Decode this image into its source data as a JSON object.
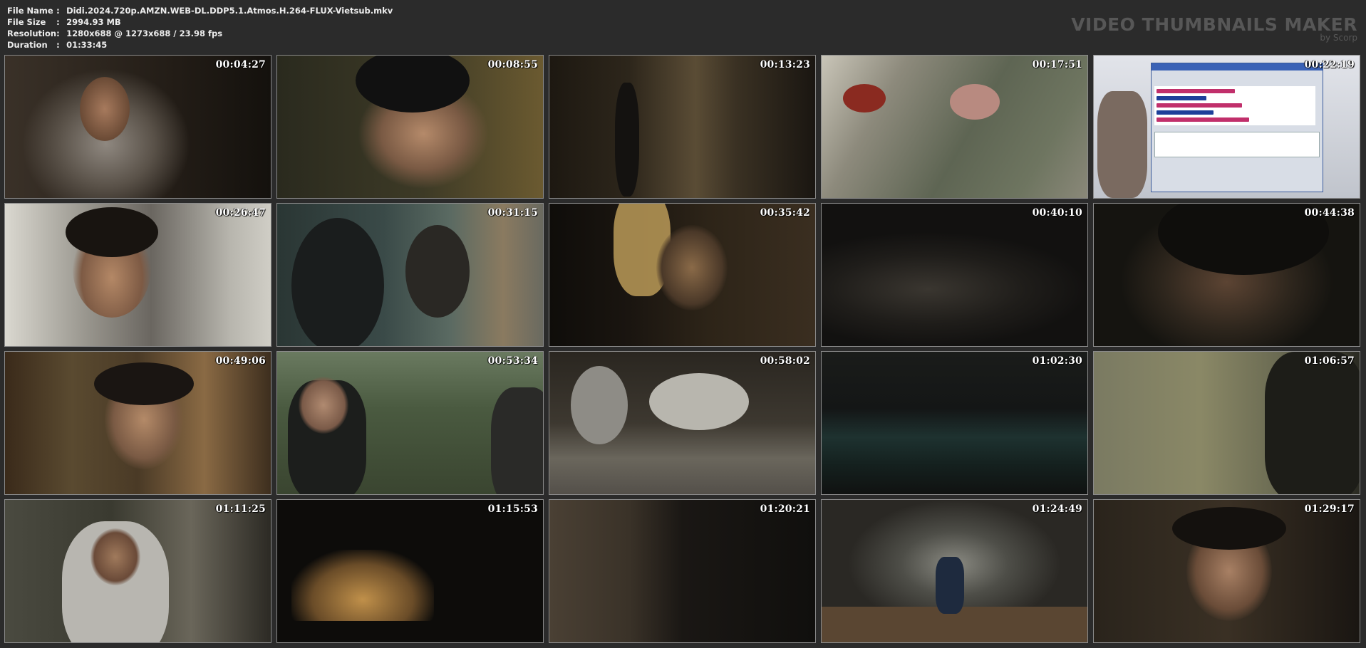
{
  "file_info": [
    {
      "key": "File Name",
      "value": "Didi.2024.720p.AMZN.WEB-DL.DDP5.1.Atmos.H.264-FLUX-Vietsub.mkv"
    },
    {
      "key": "File Size",
      "value": "2994.93 MB"
    },
    {
      "key": "Resolution",
      "value": "1280x688 @ 1273x688 / 23.98 fps"
    },
    {
      "key": "Duration",
      "value": "01:33:45"
    }
  ],
  "brand": {
    "title": "VIDEO THUMBNAILS MAKER",
    "subtitle": "by Scorp"
  },
  "thumbnails": [
    {
      "time": "00:04:27",
      "bg": "#2a241d"
    },
    {
      "time": "00:08:55",
      "bg": "#3a3524"
    },
    {
      "time": "00:13:23",
      "bg": "#2a2318"
    },
    {
      "time": "00:17:51",
      "bg": "#6a6a5c"
    },
    {
      "time": "00:22:19",
      "bg": "#c9c9cf"
    },
    {
      "time": "00:26:47",
      "bg": "#7d7a74"
    },
    {
      "time": "00:31:15",
      "bg": "#3b4a45"
    },
    {
      "time": "00:35:42",
      "bg": "#1d1812"
    },
    {
      "time": "00:40:10",
      "bg": "#1b1a18"
    },
    {
      "time": "00:44:38",
      "bg": "#1e1d17"
    },
    {
      "time": "00:49:06",
      "bg": "#3d3020"
    },
    {
      "time": "00:53:34",
      "bg": "#4c5a45"
    },
    {
      "time": "00:58:02",
      "bg": "#3f3b35"
    },
    {
      "time": "01:02:30",
      "bg": "#1c2222"
    },
    {
      "time": "01:06:57",
      "bg": "#5e6650"
    },
    {
      "time": "01:11:25",
      "bg": "#3e3c33"
    },
    {
      "time": "01:15:53",
      "bg": "#0f0e0b"
    },
    {
      "time": "01:20:21",
      "bg": "#221d17"
    },
    {
      "time": "01:24:49",
      "bg": "#3d3c36"
    },
    {
      "time": "01:29:17",
      "bg": "#2a241c"
    }
  ]
}
